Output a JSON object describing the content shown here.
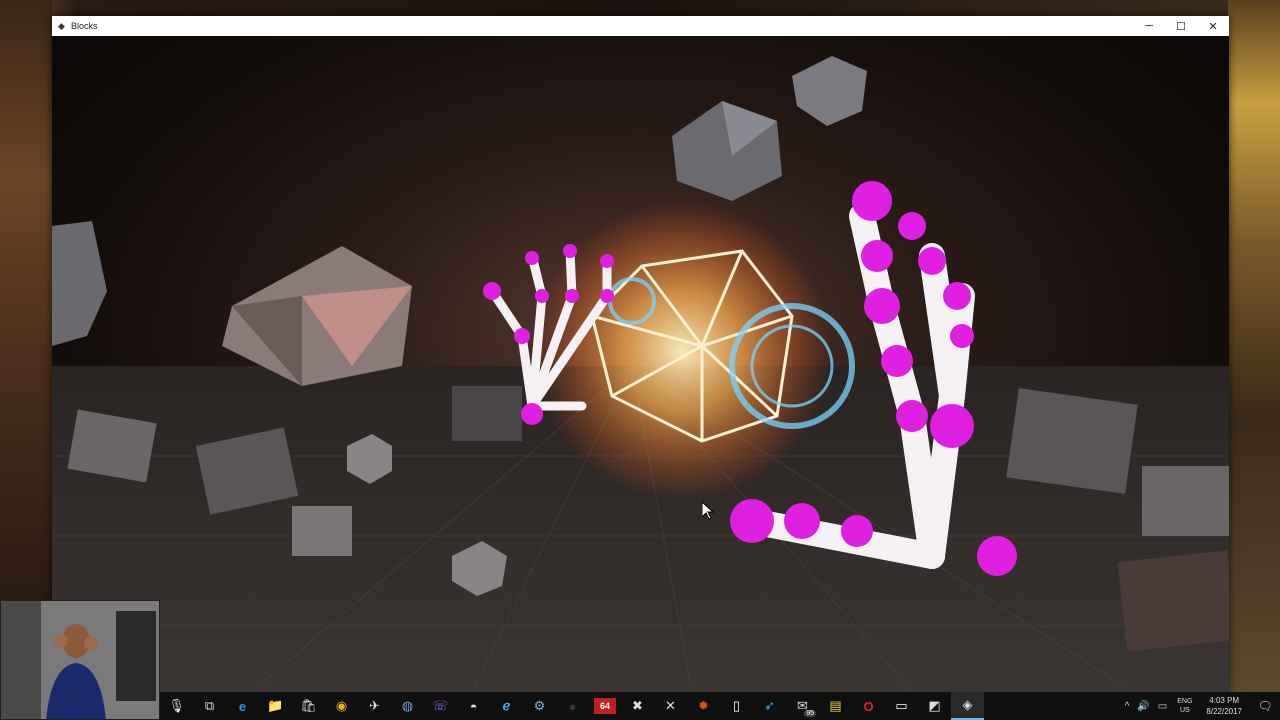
{
  "window": {
    "title": "Blocks"
  },
  "window_controls": {
    "minimize": "─",
    "maximize": "☐",
    "close": "✕"
  },
  "taskbar": {
    "pinned": [
      {
        "name": "mic-icon",
        "glyph": "🎙"
      },
      {
        "name": "task-view-icon",
        "glyph": "⧉"
      },
      {
        "name": "edge-icon",
        "glyph": "e"
      },
      {
        "name": "file-explorer-icon",
        "glyph": "📁"
      },
      {
        "name": "store-icon",
        "glyph": "🛍"
      },
      {
        "name": "chrome-icon",
        "glyph": "◉"
      },
      {
        "name": "tool-icon",
        "glyph": "✈"
      },
      {
        "name": "globe-icon",
        "glyph": "◍"
      },
      {
        "name": "viber-icon",
        "glyph": "☏"
      },
      {
        "name": "game-icon",
        "glyph": "◓"
      },
      {
        "name": "ie-icon",
        "glyph": "ℯ"
      },
      {
        "name": "steam-icon",
        "glyph": "⚙"
      },
      {
        "name": "app-dark-icon",
        "glyph": "●"
      },
      {
        "name": "n64-icon",
        "glyph": "64"
      },
      {
        "name": "xbox-icon",
        "glyph": "✖"
      },
      {
        "name": "x-app-icon",
        "glyph": "✕"
      },
      {
        "name": "tool-red-icon",
        "glyph": "✹"
      },
      {
        "name": "document-icon",
        "glyph": "▯"
      },
      {
        "name": "arrow-app-icon",
        "glyph": "➶"
      },
      {
        "name": "mail-icon",
        "glyph": "✉"
      },
      {
        "name": "sticky-notes-icon",
        "glyph": "▤"
      },
      {
        "name": "opera-icon",
        "glyph": "O"
      },
      {
        "name": "window-app-icon",
        "glyph": "▭"
      },
      {
        "name": "monitor-app-icon",
        "glyph": "◩"
      },
      {
        "name": "unity-icon",
        "glyph": "◈"
      }
    ],
    "mail_badge": "95",
    "tray": {
      "chevron": "^",
      "volume": "🔊",
      "network": "▭",
      "lang_top": "ENG",
      "lang_bottom": "US",
      "time": "4:03 PM",
      "date": "8/22/2017",
      "notification": "🗨"
    }
  },
  "colors": {
    "hand_joint": "#e020e0",
    "hand_bone": "#f4f0f4",
    "glow": "#ff8a3a",
    "ring": "#7ad4ff",
    "block": "#8a8a90"
  }
}
